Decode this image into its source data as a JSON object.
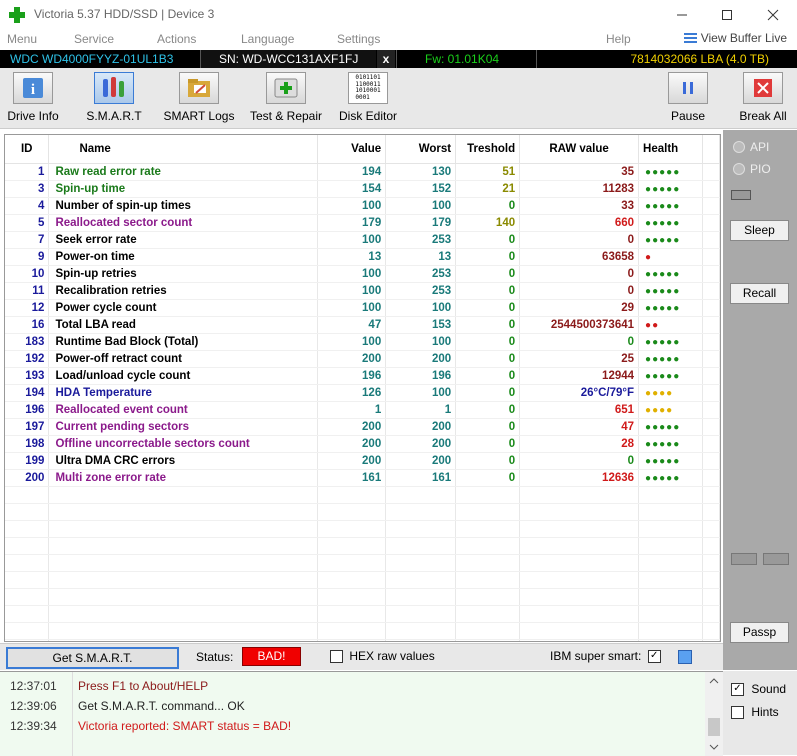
{
  "window": {
    "title": "Victoria 5.37 HDD/SSD | Device 3"
  },
  "menu": {
    "items": [
      "Menu",
      "Service",
      "Actions",
      "Language",
      "Settings"
    ],
    "help": "Help",
    "view_buffer": "View Buffer Live"
  },
  "device": {
    "model": "WDC WD4000FYYZ-01UL1B3",
    "serial": "SN: WD-WCC131AXF1FJ",
    "close": "x",
    "firmware": "Fw: 01.01K04",
    "lba": "7814032066 LBA (4.0 TB)"
  },
  "toolbar": {
    "drive_info": "Drive Info",
    "smart": "S.M.A.R.T",
    "smart_logs": "SMART Logs",
    "test_repair": "Test & Repair",
    "disk_editor": "Disk Editor",
    "disk_editor_icon_lines": [
      "0101101",
      "1100011",
      "1010001",
      "0001"
    ],
    "pause": "Pause",
    "break_all": "Break All"
  },
  "table": {
    "headers": {
      "id": "ID",
      "name": "Name",
      "value": "Value",
      "worst": "Worst",
      "treshold": "Treshold",
      "raw": "RAW value",
      "health": "Health"
    },
    "rows": [
      {
        "id": "1",
        "name": "Raw read error rate",
        "name_color": "#1a7a1a",
        "value": "194",
        "worst": "130",
        "treshold": "51",
        "treshold_color": "#8a8a00",
        "raw": "35",
        "raw_color": "#8b1a1a",
        "health": "●●●●●",
        "health_color": "#1a8a1a"
      },
      {
        "id": "3",
        "name": "Spin-up time",
        "name_color": "#1a7a1a",
        "value": "154",
        "worst": "152",
        "treshold": "21",
        "treshold_color": "#8a8a00",
        "raw": "11283",
        "raw_color": "#8b1a1a",
        "health": "●●●●●",
        "health_color": "#1a8a1a"
      },
      {
        "id": "4",
        "name": "Number of spin-up times",
        "name_color": "#000000",
        "value": "100",
        "worst": "100",
        "treshold": "0",
        "treshold_color": "#1a8a1a",
        "raw": "33",
        "raw_color": "#8b1a1a",
        "health": "●●●●●",
        "health_color": "#1a8a1a"
      },
      {
        "id": "5",
        "name": "Reallocated sector count",
        "name_color": "#8b1a8b",
        "value": "179",
        "worst": "179",
        "treshold": "140",
        "treshold_color": "#8a8a00",
        "raw": "660",
        "raw_color": "#d01a1a",
        "health": "●●●●●",
        "health_color": "#1a8a1a"
      },
      {
        "id": "7",
        "name": "Seek error rate",
        "name_color": "#000000",
        "value": "100",
        "worst": "253",
        "treshold": "0",
        "treshold_color": "#1a8a1a",
        "raw": "0",
        "raw_color": "#8b1a1a",
        "health": "●●●●●",
        "health_color": "#1a8a1a"
      },
      {
        "id": "9",
        "name": "Power-on time",
        "name_color": "#000000",
        "value": "13",
        "worst": "13",
        "treshold": "0",
        "treshold_color": "#1a8a1a",
        "raw": "63658",
        "raw_color": "#8b1a1a",
        "health": "●",
        "health_color": "#d01a1a"
      },
      {
        "id": "10",
        "name": "Spin-up retries",
        "name_color": "#000000",
        "value": "100",
        "worst": "253",
        "treshold": "0",
        "treshold_color": "#1a8a1a",
        "raw": "0",
        "raw_color": "#8b1a1a",
        "health": "●●●●●",
        "health_color": "#1a8a1a"
      },
      {
        "id": "11",
        "name": "Recalibration retries",
        "name_color": "#000000",
        "value": "100",
        "worst": "253",
        "treshold": "0",
        "treshold_color": "#1a8a1a",
        "raw": "0",
        "raw_color": "#8b1a1a",
        "health": "●●●●●",
        "health_color": "#1a8a1a"
      },
      {
        "id": "12",
        "name": "Power cycle count",
        "name_color": "#000000",
        "value": "100",
        "worst": "100",
        "treshold": "0",
        "treshold_color": "#1a8a1a",
        "raw": "29",
        "raw_color": "#8b1a1a",
        "health": "●●●●●",
        "health_color": "#1a8a1a"
      },
      {
        "id": "16",
        "name": "Total LBA read",
        "name_color": "#000000",
        "value": "47",
        "worst": "153",
        "treshold": "0",
        "treshold_color": "#1a8a1a",
        "raw": "2544500373641",
        "raw_color": "#8b1a1a",
        "health": "●●",
        "health_color": "#d01a1a"
      },
      {
        "id": "183",
        "name": "Runtime Bad Block (Total)",
        "name_color": "#000000",
        "value": "100",
        "worst": "100",
        "treshold": "0",
        "treshold_color": "#1a8a1a",
        "raw": "0",
        "raw_color": "#1a8a1a",
        "health": "●●●●●",
        "health_color": "#1a8a1a"
      },
      {
        "id": "192",
        "name": "Power-off retract count",
        "name_color": "#000000",
        "value": "200",
        "worst": "200",
        "treshold": "0",
        "treshold_color": "#1a8a1a",
        "raw": "25",
        "raw_color": "#8b1a1a",
        "health": "●●●●●",
        "health_color": "#1a8a1a"
      },
      {
        "id": "193",
        "name": "Load/unload cycle count",
        "name_color": "#000000",
        "value": "196",
        "worst": "196",
        "treshold": "0",
        "treshold_color": "#1a8a1a",
        "raw": "12944",
        "raw_color": "#8b1a1a",
        "health": "●●●●●",
        "health_color": "#1a8a1a"
      },
      {
        "id": "194",
        "name": "HDA Temperature",
        "name_color": "#1a1a9b",
        "value": "126",
        "worst": "100",
        "treshold": "0",
        "treshold_color": "#1a8a1a",
        "raw": "26°C/79°F",
        "raw_color": "#1a1a9b",
        "health": "●●●●",
        "health_color": "#e0b000"
      },
      {
        "id": "196",
        "name": "Reallocated event count",
        "name_color": "#8b1a8b",
        "value": "1",
        "worst": "1",
        "treshold": "0",
        "treshold_color": "#1a8a1a",
        "raw": "651",
        "raw_color": "#d01a1a",
        "health": "●●●●",
        "health_color": "#e0b000"
      },
      {
        "id": "197",
        "name": "Current pending sectors",
        "name_color": "#8b1a8b",
        "value": "200",
        "worst": "200",
        "treshold": "0",
        "treshold_color": "#1a8a1a",
        "raw": "47",
        "raw_color": "#d01a1a",
        "health": "●●●●●",
        "health_color": "#1a8a1a"
      },
      {
        "id": "198",
        "name": "Offline uncorrectable sectors count",
        "name_color": "#8b1a8b",
        "value": "200",
        "worst": "200",
        "treshold": "0",
        "treshold_color": "#1a8a1a",
        "raw": "28",
        "raw_color": "#d01a1a",
        "health": "●●●●●",
        "health_color": "#1a8a1a"
      },
      {
        "id": "199",
        "name": "Ultra DMA CRC errors",
        "name_color": "#000000",
        "value": "200",
        "worst": "200",
        "treshold": "0",
        "treshold_color": "#1a8a1a",
        "raw": "0",
        "raw_color": "#1a8a1a",
        "health": "●●●●●",
        "health_color": "#1a8a1a"
      },
      {
        "id": "200",
        "name": "Multi zone error rate",
        "name_color": "#8b1a8b",
        "value": "161",
        "worst": "161",
        "treshold": "0",
        "treshold_color": "#1a8a1a",
        "raw": "12636",
        "raw_color": "#d01a1a",
        "health": "●●●●●",
        "health_color": "#1a8a1a"
      }
    ]
  },
  "side": {
    "api": "API",
    "pio": "PIO",
    "sleep": "Sleep",
    "recall": "Recall",
    "passp": "Passp"
  },
  "status": {
    "get_smart": "Get S.M.A.R.T.",
    "status_label": "Status:",
    "status_value": "BAD!",
    "hex_raw": "HEX raw values",
    "ibm": "IBM super smart:",
    "ibm_checked": "✓"
  },
  "log": [
    {
      "time": "12:37:01",
      "msg": "Press F1 to About/HELP",
      "color": "#8b1a1a"
    },
    {
      "time": "12:39:06",
      "msg": "Get S.M.A.R.T. command... OK",
      "color": "#222222"
    },
    {
      "time": "12:39:34",
      "msg": "Victoria reported: SMART status = BAD!",
      "color": "#d01a1a"
    }
  ],
  "options": {
    "sound": "Sound",
    "sound_checked": "✓",
    "hints": "Hints"
  }
}
